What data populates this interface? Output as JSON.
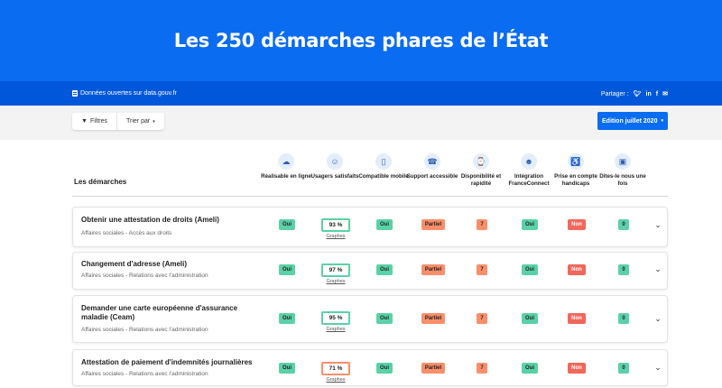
{
  "hero": {
    "title": "Les 250 démarches phares de l’État"
  },
  "sharebar": {
    "open_data": "Données ouvertes sur data.gouv.fr",
    "share_label": "Partager :",
    "networks": [
      "twitter",
      "linkedin",
      "facebook",
      "email"
    ]
  },
  "toolbar": {
    "filters": "Filtres",
    "sort": "Trier par",
    "edition": "Edition juillet 2020"
  },
  "table": {
    "title": "Les démarches",
    "columns": [
      {
        "label": "Réalisable en ligne",
        "icon": "cloud-icon"
      },
      {
        "label": "Usagers satisfaits",
        "icon": "smiley-icon"
      },
      {
        "label": "Compatible mobile",
        "icon": "mobile-icon"
      },
      {
        "label": "Support accessible",
        "icon": "headset-icon"
      },
      {
        "label": "Disponibilité et rapidité",
        "icon": "watch-icon"
      },
      {
        "label": "Intégration FranceConnect",
        "icon": "user-icon"
      },
      {
        "label": "Prise en compte handicaps",
        "icon": "accessibility-icon"
      },
      {
        "label": "Dites-le nous une fois",
        "icon": "briefcase-icon"
      }
    ],
    "graph_link": "Graphes",
    "rows": [
      {
        "name": "Obtenir une attestation de droits (Ameli)",
        "sub": "Affaires sociales - Accès aux droits",
        "online": "Oui",
        "satisfaction": "93 %",
        "mobile": "Oui",
        "support": "Partiel",
        "availability": "7",
        "franceconnect": "Oui",
        "handicap": "Non",
        "once": "0"
      },
      {
        "name": "Changement d'adresse (Ameli)",
        "sub": "Affaires sociales - Relations avec l'administration",
        "online": "Oui",
        "satisfaction": "97 %",
        "mobile": "Oui",
        "support": "Partiel",
        "availability": "7",
        "franceconnect": "Oui",
        "handicap": "Non",
        "once": "0"
      },
      {
        "name": "Demander une carte européenne d'assurance maladie (Ceam)",
        "sub": "Affaires sociales - Relations avec l'administration",
        "online": "Oui",
        "satisfaction": "95 %",
        "mobile": "Oui",
        "support": "Partiel",
        "availability": "7",
        "franceconnect": "Oui",
        "handicap": "Non",
        "once": "0"
      },
      {
        "name": "Attestation de paiement d'indemnités journalières",
        "sub": "Affaires sociales - Relations avec l'administration",
        "online": "Oui",
        "satisfaction": "71 %",
        "mobile": "Oui",
        "support": "Partiel",
        "availability": "7",
        "franceconnect": "Oui",
        "handicap": "Non",
        "once": "0"
      }
    ]
  },
  "colors": {
    "primary": "#0a6cf0",
    "green": "#5ad1a6",
    "orange": "#f98f6a",
    "red": "#f1675b"
  }
}
